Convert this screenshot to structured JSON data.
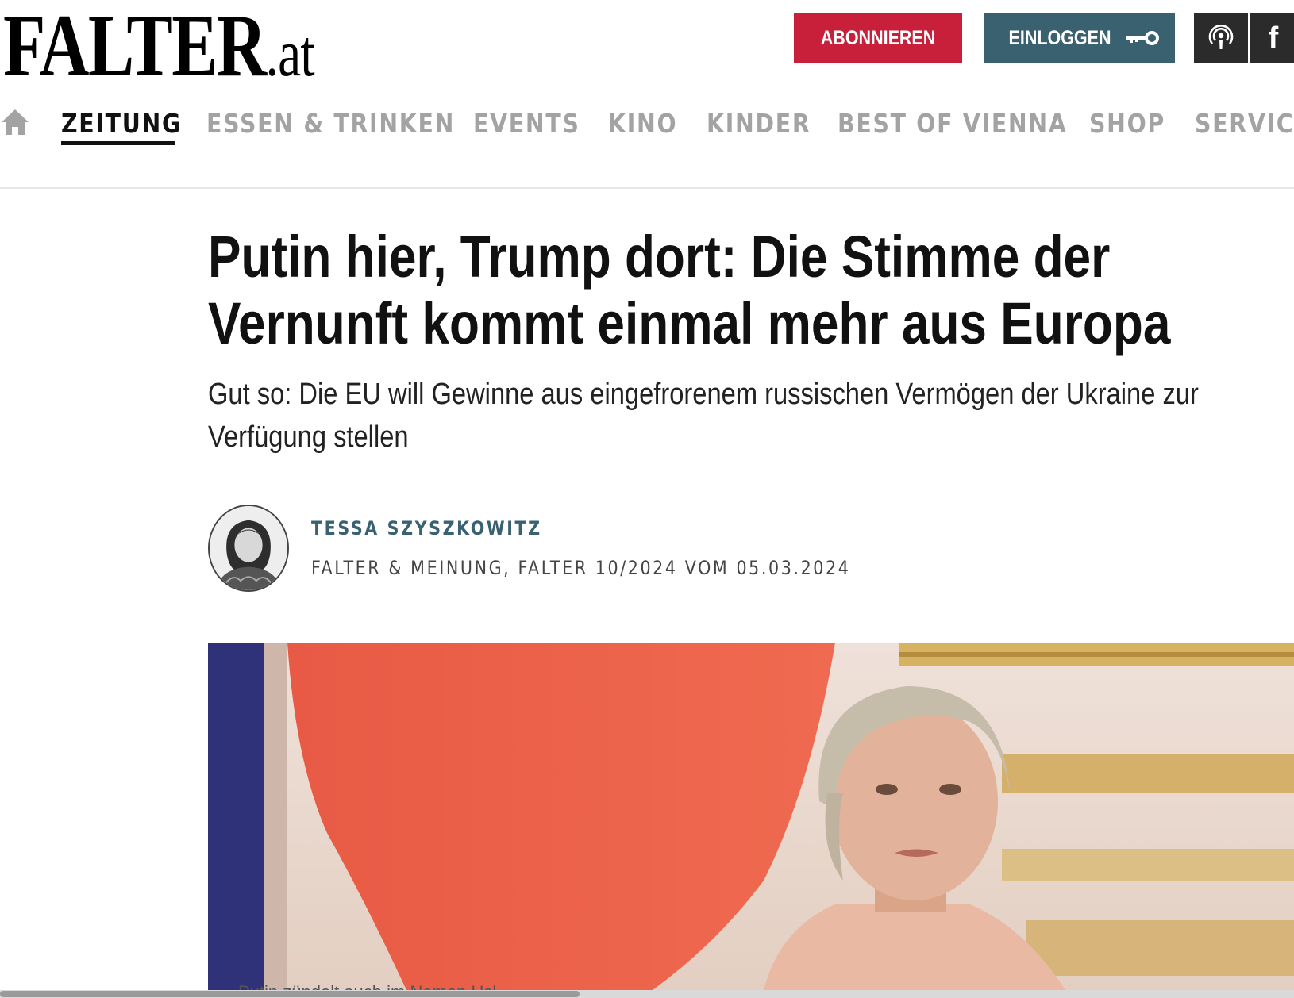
{
  "header": {
    "logo_main": "FALTER",
    "logo_tld": ".at",
    "subscribe_label": "ABONNIEREN",
    "login_label": "EINLOGGEN",
    "facebook_label": "f"
  },
  "nav": {
    "items": [
      {
        "label": "ZEITUNG",
        "active": true
      },
      {
        "label": "ESSEN & TRINKEN"
      },
      {
        "label": "EVENTS"
      },
      {
        "label": "KINO"
      },
      {
        "label": "KINDER"
      },
      {
        "label": "BEST OF VIENNA"
      },
      {
        "label": "SHOP"
      },
      {
        "label": "SERVICE"
      }
    ]
  },
  "article": {
    "headline": "Putin hier, Trump dort: Die Stimme der Vernunft kommt einmal mehr aus Europa",
    "subtitle": "Gut so: Die EU will Gewinne aus eingefrorenem russischen Vermögen der Ukraine zur Verfügung stellen",
    "author": "TESSA SZYSZKOWITZ",
    "meta": "FALTER & MEINUNG, FALTER 10/2024 VOM 05.03.2024",
    "caption": "Putin zündelt auch im Namen Usl"
  },
  "colors": {
    "subscribe_bg": "#c8203a",
    "login_bg": "#3a6170",
    "author_color": "#3a6170",
    "nav_inactive": "#a3a3a3"
  }
}
